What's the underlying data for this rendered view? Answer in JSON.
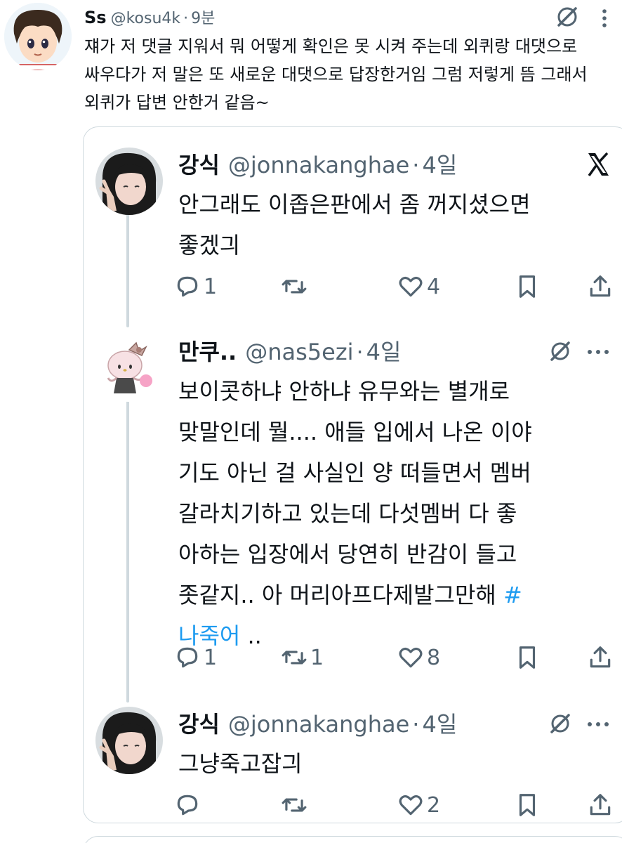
{
  "outer_tweet": {
    "name": "Ss",
    "handle": "@kosu4k",
    "separator": "·",
    "time": "9분",
    "text": "쟤가 저 댓글 지워서 뭐 어떻게 확인은 못 시켜 주는데 외퀴랑 대댓으로\n싸우다가 저 말은 또 새로운 대댓으로 답장한거임 그럼 저렇게 뜸 그래서\n외퀴가 답변 안한거 같음~",
    "icons": [
      "grok-icon",
      "more-icon"
    ]
  },
  "quoted": [
    {
      "name": "강식",
      "handle": "@jonnakanghae",
      "separator": "·",
      "time": "4일",
      "text": "안그래도 이좁은판에서 좀 꺼지셨으면\n좋겠긔",
      "hashtag": "",
      "trailing": "",
      "replies": "1",
      "retweets": "",
      "likes": "4"
    },
    {
      "name": "만쿠..",
      "handle": "@nas5ezi",
      "separator": "·",
      "time": "4일",
      "text": "보이콧하냐 안하냐 유무와는 별개로\n맞말인데 뭘.... 애들 입에서 나온 이야\n기도 아닌 걸 사실인 양 떠들면서 멤버\n갈라치기하고 있는데 다섯멤버 다 좋\n아하는 입장에서 당연히 반감이 들고\n좃같지.. 아 머리아프다제발그만해 ",
      "hashtag": "#\n나죽어",
      "trailing": " ..",
      "replies": "1",
      "retweets": "1",
      "likes": "8"
    },
    {
      "name": "강식",
      "handle": "@jonnakanghae",
      "separator": "·",
      "time": "4일",
      "text": "그냥죽고잡긔",
      "hashtag": "",
      "trailing": "",
      "replies": "",
      "retweets": "",
      "likes": "2"
    }
  ],
  "colors": {
    "text": "#0f1419",
    "secondary": "#536471",
    "hashtag": "#1d9bf0",
    "border": "#cfd9de"
  }
}
